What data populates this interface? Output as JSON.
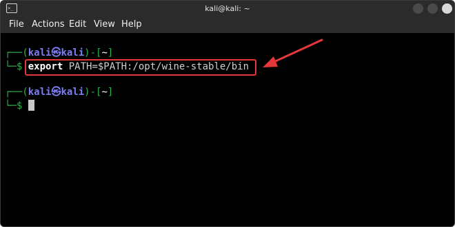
{
  "window": {
    "title": "kali@kali: ~"
  },
  "menu": {
    "items": [
      "File",
      "Actions",
      "Edit",
      "View",
      "Help"
    ]
  },
  "terminal": {
    "prompt1": {
      "corner": "┌──(",
      "user": "kali",
      "at": "㉿",
      "host": "kali",
      "sep": ")-[",
      "dir": "~",
      "close": "]"
    },
    "line1_prefix": "└─$ ",
    "command_keyword": "export",
    "command_rest": " PATH=$PATH:/opt/wine-stable/bin",
    "prompt2": {
      "corner": "┌──(",
      "user": "kali",
      "at": "㉿",
      "host": "kali",
      "sep": ")-[",
      "dir": "~",
      "close": "]"
    },
    "line2_prefix": "└─$ "
  },
  "colors": {
    "annotation": "#e5383b",
    "prompt_green": "#2fb24e",
    "prompt_blue": "#7d7df4"
  }
}
